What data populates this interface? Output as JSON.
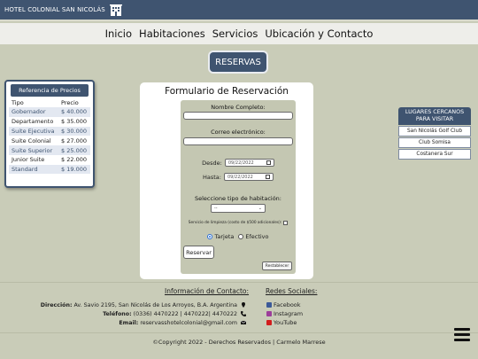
{
  "header": {
    "brand": "HOTEL COLONIAL SAN NICOLÁS",
    "brand_icon": "hotel-building-icon",
    "bg_color": "#3f5470"
  },
  "nav": {
    "items": [
      "Inicio",
      "Habitaciones",
      "Servicios",
      "Ubicación y Contacto"
    ]
  },
  "reservas_button": "RESERVAS",
  "prices": {
    "title": "Referencia de Precios",
    "col_tipo": "Tipo",
    "col_precio": "Precio",
    "rows": [
      {
        "tipo": "Gobernador",
        "precio": "$ 40.000"
      },
      {
        "tipo": "Departamento",
        "precio": "$ 35.000"
      },
      {
        "tipo": "Suite Ejecutiva",
        "precio": "$ 30.000"
      },
      {
        "tipo": "Suite Colonial",
        "precio": "$ 27.000"
      },
      {
        "tipo": "Suite Superior",
        "precio": "$ 25.000"
      },
      {
        "tipo": "Junior Suite",
        "precio": "$ 22.000"
      },
      {
        "tipo": "Standard",
        "precio": "$ 19.000"
      }
    ]
  },
  "form": {
    "title": "Formulario de Reservación",
    "name_label": "Nombre Completo:",
    "name_value": "",
    "email_label": "Correo electrónico:",
    "email_value": "",
    "desde_label": "Desde:",
    "desde_value": "09/22/2022",
    "hasta_label": "Hasta:",
    "hasta_value": "09/22/2022",
    "room_label": "Seleccione tipo de habitación:",
    "room_value": "--",
    "cleaning_label": "Servicio de limpieza (costo de $500 adicionales):",
    "cleaning_checked": false,
    "payment_options": [
      "Tarjeta",
      "Efectivo"
    ],
    "payment_selected": "Tarjeta",
    "submit": "Reservar",
    "reset": "Restablecer"
  },
  "nearby": {
    "title": "LUGARES CERCANOS PARA VISITAR",
    "items": [
      "San Nicolás Golf Club",
      "Club Somisa",
      "Costanera Sur"
    ]
  },
  "footer": {
    "contact_title": "Información de Contacto:",
    "address_label": "Dirección:",
    "address": "Av. Savio 2195, San Nicolás de Los Arroyos, B.A. Argentina",
    "phone_label": "Teléfono:",
    "phone": "(0336) 4470222 | 4470222| 4470222",
    "email_label": "Email:",
    "email": "reservasshotelcolonial@gmail.com",
    "social_title": "Redes Sociales:",
    "social": [
      {
        "name": "Facebook",
        "icon": "facebook-icon",
        "color": "#3b5998"
      },
      {
        "name": "Instagram",
        "icon": "instagram-icon",
        "color": "#9c3d9a"
      },
      {
        "name": "YouTube",
        "icon": "youtube-icon",
        "color": "#d21d1d"
      }
    ],
    "copyright": "©Copyright 2022 - Derechos Reservados | Carmelo Marrese"
  }
}
